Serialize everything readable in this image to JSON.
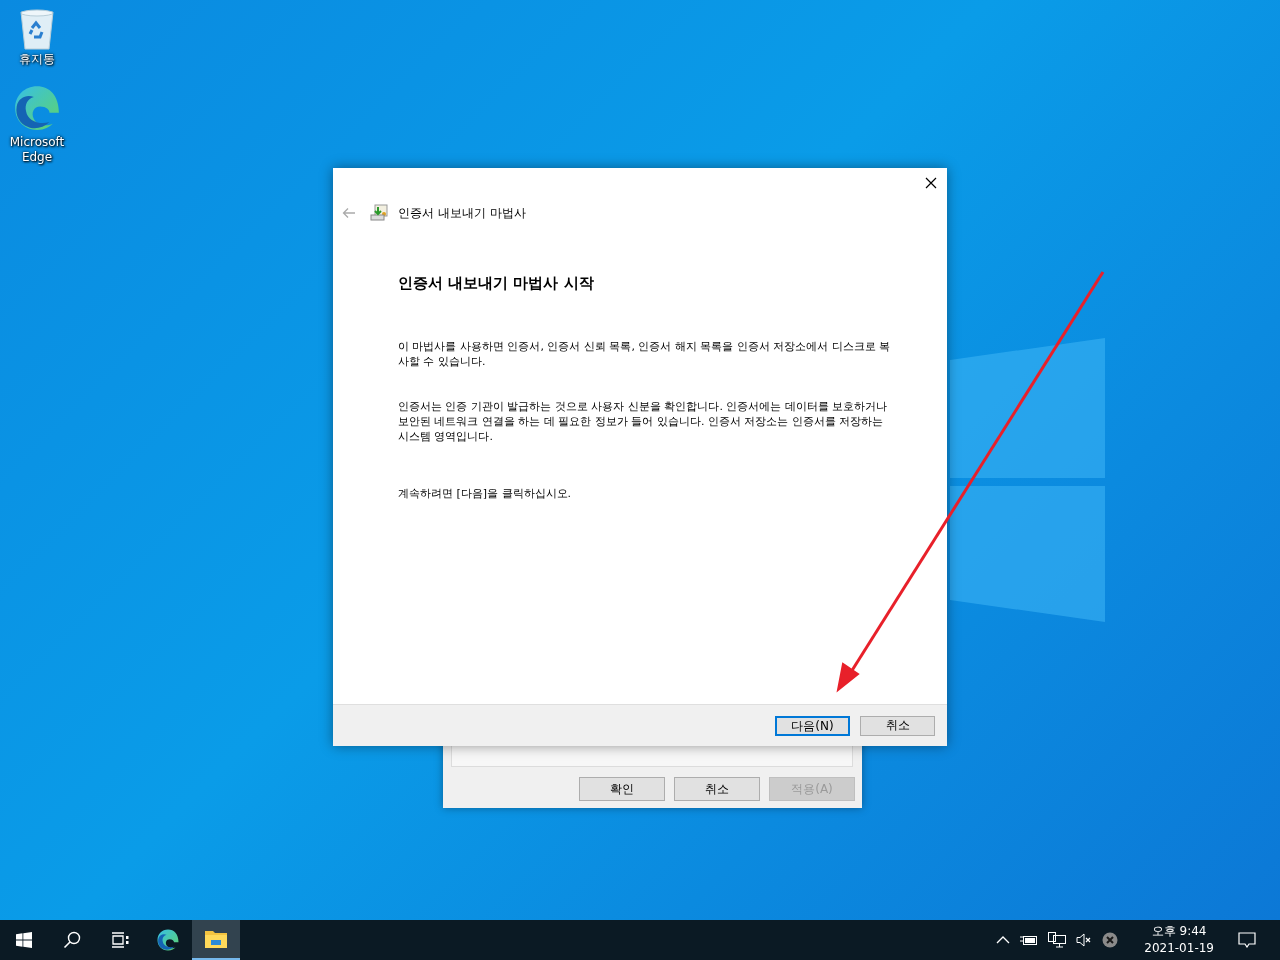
{
  "desktop_icons": [
    {
      "kind": "recycle-bin",
      "label": "휴지통"
    },
    {
      "kind": "edge",
      "label": "Microsoft Edge"
    }
  ],
  "background_dialog": {
    "buttons": [
      {
        "label": "확인",
        "disabled": false
      },
      {
        "label": "취소",
        "disabled": false
      },
      {
        "label": "적용(A)",
        "disabled": true
      }
    ]
  },
  "wizard": {
    "title": "인증서 내보내기 마법사",
    "heading": "인증서 내보내기 마법사 시작",
    "paragraphs": [
      "이 마법사를 사용하면 인증서, 인증서 신뢰 목록, 인증서 해지 목록을 인증서 저장소에서 디스크로 복사할 수 있습니다.",
      "인증서는 인증 기관이 발급하는 것으로 사용자 신분을 확인합니다. 인증서에는 데이터를 보호하거나 보안된 네트워크 연결을 하는 데 필요한 정보가 들어 있습니다. 인증서 저장소는 인증서를 저장하는 시스템 영역입니다.",
      "계속하려면 [다음]을 클릭하십시오."
    ],
    "buttons": [
      {
        "label": "다음(N)",
        "default": true
      },
      {
        "label": "취소",
        "default": false
      }
    ]
  },
  "taskbar": {
    "items": [
      {
        "kind": "start",
        "selected": false
      },
      {
        "kind": "search",
        "selected": false
      },
      {
        "kind": "task-view",
        "selected": false
      },
      {
        "kind": "edge",
        "selected": false
      },
      {
        "kind": "file-explorer",
        "selected": true
      }
    ],
    "tray": [
      {
        "kind": "chevron"
      },
      {
        "kind": "battery"
      },
      {
        "kind": "network"
      },
      {
        "kind": "volume-muted"
      },
      {
        "kind": "error"
      }
    ],
    "time": "오후 9:44",
    "date": "2021-01-19"
  }
}
